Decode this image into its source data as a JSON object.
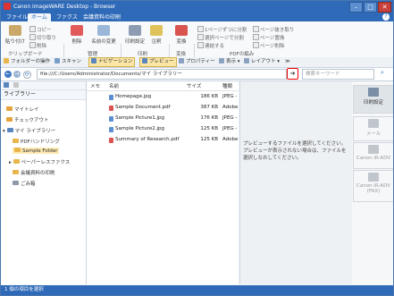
{
  "window": {
    "title": "Canon imageWARE Desktop - Browser"
  },
  "menu": {
    "tabs": [
      "ファイル",
      "ホーム",
      "ファクス",
      "会議資料の印刷"
    ],
    "help": "?"
  },
  "ribbon": {
    "paste": "貼り付け",
    "copy": "コピー",
    "cut": "切り取り",
    "delete_small": "削除",
    "delete": "削除",
    "rename": "名前の変更",
    "print_settings": "印刷設定",
    "annotate": "注釈",
    "convert": "変換",
    "split1": "1ページずつに分割",
    "split_selected": "選択ページで分割",
    "merge": "連結する",
    "reorder": "ページ抜き取り",
    "page_replace": "ページ置換",
    "page_delete": "ページ削除",
    "groups": {
      "clipboard": "クリップボード",
      "manage": "管理",
      "print": "印刷",
      "convert": "変換",
      "pdf": "PDFの編み"
    }
  },
  "toolbar": {
    "folder_ops": "フォルダーの操作",
    "scan": "スキャン",
    "navigation": "ナビゲーション",
    "preview": "プレビュー",
    "property": "プロパティー",
    "view": "表示",
    "layout": "レイアウト",
    "more": "≫"
  },
  "address": {
    "path": "file:///C:/Users/Administrator/Documents/マイ ライブラリー",
    "search_placeholder": "検索キーワード",
    "go": "➜"
  },
  "library": {
    "header": "ライブラリー",
    "items": [
      {
        "label": "マイトレイ"
      },
      {
        "label": "チェックアウト"
      },
      {
        "label": "マイ ライブラリー"
      },
      {
        "label": "PDFハンドリング"
      },
      {
        "label": "Sample Folder"
      },
      {
        "label": "ペーパーレスファクス"
      },
      {
        "label": "会議資料の印刷"
      },
      {
        "label": "ごみ箱"
      }
    ]
  },
  "files": {
    "columns": {
      "memo": "メモ",
      "name": "名前",
      "size": "サイズ",
      "type": "種類"
    },
    "rows": [
      {
        "name": "Homepage.jpg",
        "size": "186 KB",
        "type": "JPEG -",
        "kind": "jpg"
      },
      {
        "name": "Sample Document.pdf",
        "size": "387 KB",
        "type": "Adobe",
        "kind": "pdf"
      },
      {
        "name": "Sample Picture1.jpg",
        "size": "176 KB",
        "type": "JPEG -",
        "kind": "jpg"
      },
      {
        "name": "Sample Picture2.jpg",
        "size": "125 KB",
        "type": "JPEG -",
        "kind": "jpg"
      },
      {
        "name": "Summary of Research.pdf",
        "size": "125 KB",
        "type": "Adobe",
        "kind": "pdf"
      }
    ]
  },
  "preview": {
    "message": "プレビューするファイルを選択してください。プレビューが表示されない場合は、ファイルを選択しなおしてください。"
  },
  "right_panel": {
    "items": [
      "印刷設定",
      "メール",
      "Canon iR-ADV",
      "Canon iR-ADV (FAX)"
    ]
  },
  "status": {
    "text": "1 個の項目を選択"
  },
  "colors": {
    "accent": "#2f6ab8",
    "highlight": "#fce8b0",
    "go_border": "#e00000"
  }
}
